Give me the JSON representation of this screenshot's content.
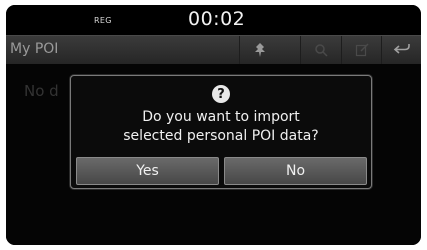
{
  "status_bar": {
    "reg_label": "REG",
    "time": "00:02"
  },
  "title_bar": {
    "title": "My POI",
    "buttons": [
      {
        "icon": "pin-icon",
        "enabled": true
      },
      {
        "icon": "search-icon",
        "enabled": false
      },
      {
        "icon": "edit-icon",
        "enabled": false
      },
      {
        "icon": "back-icon",
        "enabled": true
      }
    ]
  },
  "content": {
    "empty_text": "No d"
  },
  "dialog": {
    "icon": "question-icon",
    "icon_glyph": "?",
    "message_line1": "Do you want to import",
    "message_line2": "selected personal POI data?",
    "yes_label": "Yes",
    "no_label": "No"
  },
  "colors": {
    "background": "#050505",
    "title_bar": "#303030",
    "button": "#5a5a5a",
    "text": "#f0f0f0",
    "disabled_icon": "#4a4a4a"
  }
}
